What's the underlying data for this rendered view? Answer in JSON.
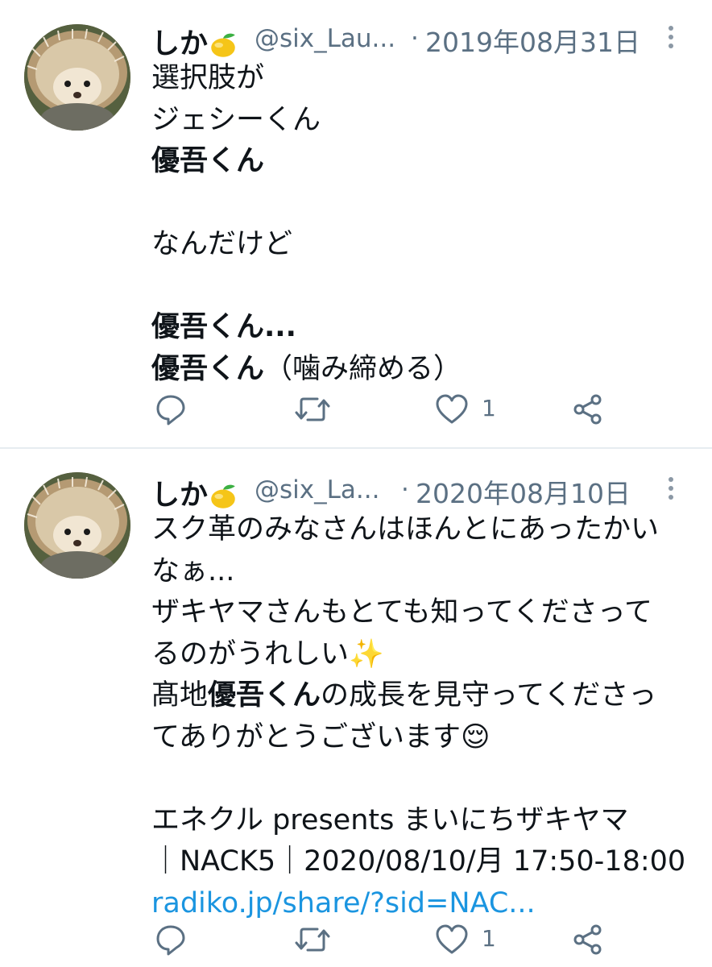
{
  "tweets": [
    {
      "name": "しか",
      "handle": "@six_Lau...",
      "separator": "·",
      "date": "2019年08月31日",
      "lines": [
        {
          "text": "選択肢が",
          "bold": false
        },
        {
          "text": "ジェシーくん",
          "bold": false
        },
        {
          "text": "優吾くん",
          "bold": true
        },
        {
          "text": "",
          "bold": false
        },
        {
          "text": "なんだけど",
          "bold": false
        },
        {
          "text": "",
          "bold": false
        },
        {
          "text": "優吾くん...",
          "bold": true
        },
        {
          "bold_text": "優吾くん",
          "text": "（噛み締める）"
        }
      ],
      "like_count": "1"
    },
    {
      "name": "しか",
      "handle": "@six_La...",
      "separator": "·",
      "date": "2020年08月10日",
      "lines": [
        {
          "text": "スク革のみなさんはほんとにあったかい"
        },
        {
          "text": "なぁ..."
        },
        {
          "text": "ザキヤマさんもとても知ってくださって"
        },
        {
          "text": "るのがうれしい✨"
        },
        {
          "prefix": "髙地",
          "bold_text": "優吾くん",
          "text": "の成長を見守ってくださっ"
        },
        {
          "text": "てありがとうございます😌"
        },
        {
          "text": ""
        },
        {
          "text": "エネクル presents まいにちザキヤマ"
        },
        {
          "text": "｜NACK5｜2020/08/10/月 17:50-18:00"
        }
      ],
      "link": "radiko.jp/share/?sid=NAC...",
      "like_count": "1"
    }
  ],
  "icons": {
    "reply": "reply-icon",
    "retweet": "retweet-icon",
    "like": "heart-icon",
    "share": "share-icon",
    "more": "more-vertical-icon",
    "name_emoji": "lemon-icon"
  },
  "colors": {
    "secondary_text": "#5b7083",
    "link": "#1b95e0",
    "divider": "#e6ecf0"
  }
}
